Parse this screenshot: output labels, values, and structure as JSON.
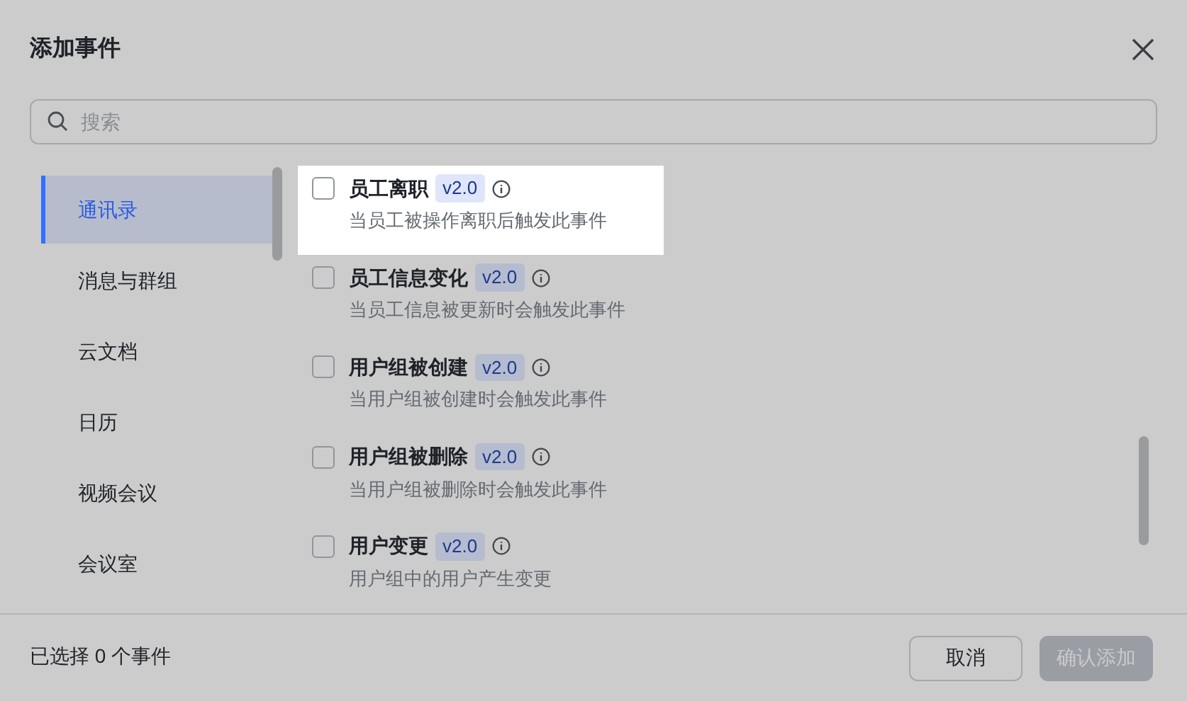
{
  "dialog": {
    "title": "添加事件"
  },
  "search": {
    "placeholder": "搜索"
  },
  "categories": [
    {
      "label": "通讯录",
      "selected": true
    },
    {
      "label": "消息与群组",
      "selected": false
    },
    {
      "label": "云文档",
      "selected": false
    },
    {
      "label": "日历",
      "selected": false
    },
    {
      "label": "视频会议",
      "selected": false
    },
    {
      "label": "会议室",
      "selected": false
    }
  ],
  "events": [
    {
      "name": "员工离职",
      "version": "v2.0",
      "description": "当员工被操作离职后触发此事件",
      "checked": false,
      "highlighted": true
    },
    {
      "name": "员工信息变化",
      "version": "v2.0",
      "description": "当员工信息被更新时会触发此事件",
      "checked": false,
      "highlighted": false
    },
    {
      "name": "用户组被创建",
      "version": "v2.0",
      "description": "当用户组被创建时会触发此事件",
      "checked": false,
      "highlighted": false
    },
    {
      "name": "用户组被删除",
      "version": "v2.0",
      "description": "当用户组被删除时会触发此事件",
      "checked": false,
      "highlighted": false
    },
    {
      "name": "用户变更",
      "version": "v2.0",
      "description": "用户组中的用户产生变更",
      "checked": false,
      "highlighted": false
    }
  ],
  "footer": {
    "summary": "已选择 0 个事件",
    "cancel": "取消",
    "confirm": {
      "label": "确认添加",
      "disabled": true
    }
  }
}
